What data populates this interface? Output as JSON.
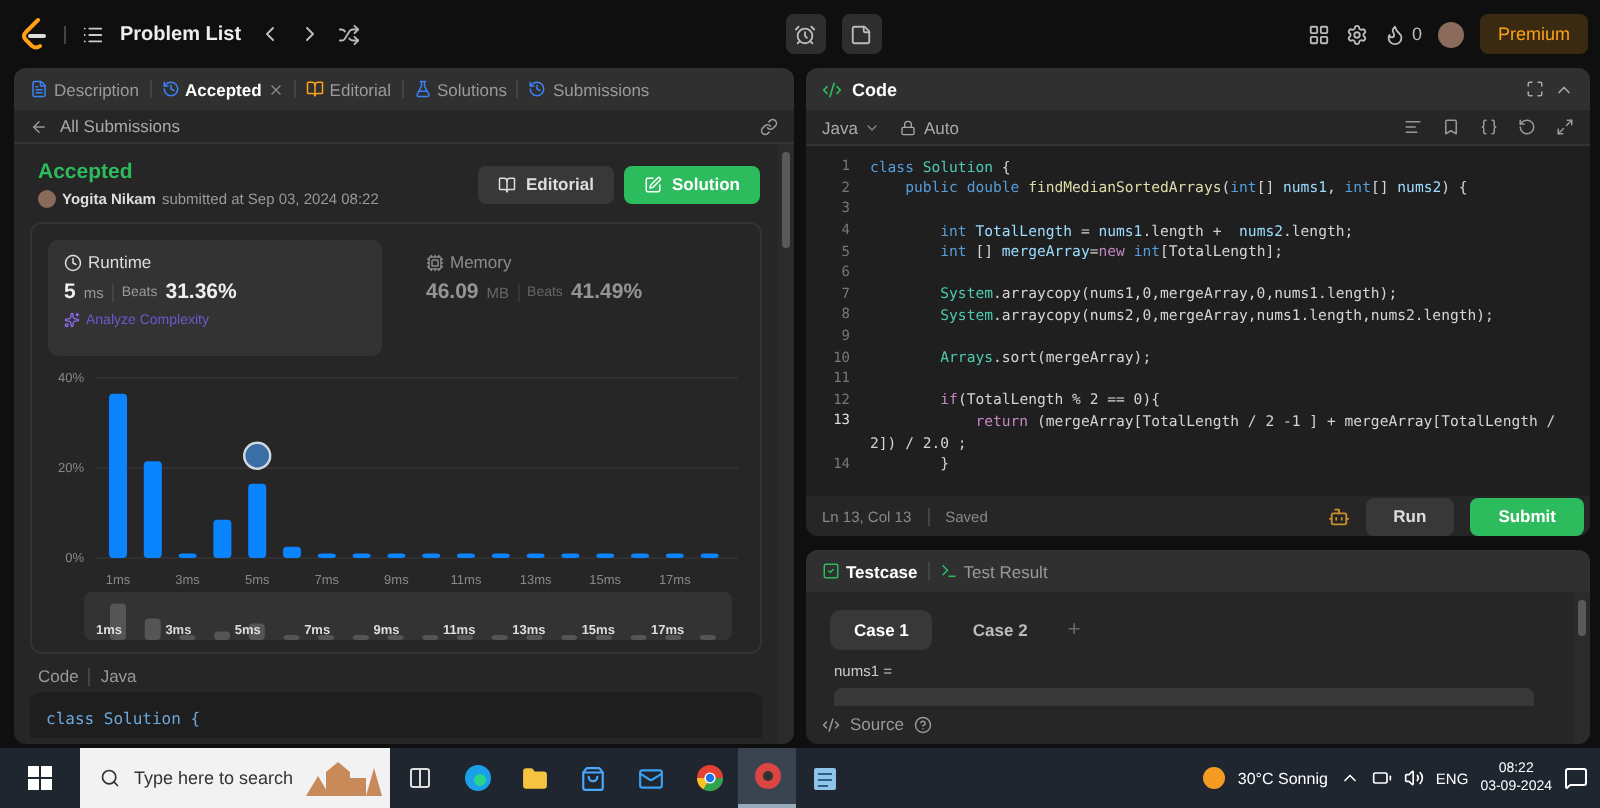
{
  "topbar": {
    "title": "Problem List",
    "streak": "0",
    "premium": "Premium"
  },
  "left": {
    "tabs": [
      {
        "label": "Description",
        "selected": false,
        "closable": false
      },
      {
        "label": "Accepted",
        "selected": true,
        "closable": true
      },
      {
        "label": "Editorial",
        "selected": false,
        "closable": false
      },
      {
        "label": "Solutions",
        "selected": false,
        "closable": false
      },
      {
        "label": "Submissions",
        "selected": false,
        "closable": false
      }
    ],
    "back": "All Submissions",
    "submission": {
      "status": "Accepted",
      "author": "Yogita Nikam",
      "submitted": "submitted at Sep 03, 2024 08:22"
    },
    "buttons": [
      {
        "label": "Editorial",
        "kind": "secondary"
      },
      {
        "label": "Solution",
        "kind": "primary"
      }
    ],
    "stats": [
      {
        "title": "Runtime",
        "value": "5",
        "unit": "ms",
        "beats_label": "Beats",
        "beats": "31.36%",
        "selected": true,
        "extra": "Analyze Complexity"
      },
      {
        "title": "Memory",
        "value": "46.09",
        "unit": "MB",
        "beats_label": "Beats",
        "beats": "41.49%",
        "selected": false
      }
    ],
    "chart_data": {
      "type": "bar",
      "categories": [
        "1ms",
        null,
        "3ms",
        null,
        "5ms",
        null,
        "7ms",
        null,
        "9ms",
        null,
        "11ms",
        null,
        "13ms",
        null,
        "15ms",
        null,
        "17ms",
        null
      ],
      "series": [
        {
          "color": "#0a84ff",
          "values": [
            36.5,
            21.5,
            1,
            8.5,
            16.5,
            2.5,
            1,
            1,
            1,
            1,
            1,
            1,
            1,
            1,
            1,
            1,
            1,
            1
          ]
        }
      ],
      "ylim": [
        0,
        40
      ],
      "yticks": [
        {
          "value": 0,
          "label": "0%"
        },
        {
          "value": 20,
          "label": "20%"
        },
        {
          "value": 40,
          "label": "40%"
        }
      ],
      "annotations": [
        {
          "x": "5ms"
        }
      ]
    },
    "brush_labels": [
      "1ms",
      "3ms",
      "5ms",
      "7ms",
      "9ms",
      "11ms",
      "13ms",
      "15ms",
      "17ms"
    ],
    "code_header": {
      "label": "Code",
      "language": "Java"
    },
    "code_preview": "class Solution {"
  },
  "editor": {
    "title": "Code",
    "language": "Java",
    "mode": "Auto",
    "lines": [
      {
        "n": "1",
        "tokens": [
          {
            "kind": "kw",
            "text": "class "
          },
          {
            "kind": "type",
            "text": "Solution"
          },
          {
            "kind": "plain",
            "text": " {"
          }
        ]
      },
      {
        "n": "2",
        "tokens": [
          {
            "kind": "kw",
            "text": "    public double "
          },
          {
            "kind": "fn",
            "text": "findMedianSortedArrays"
          },
          {
            "kind": "plain",
            "text": "("
          },
          {
            "kind": "kw",
            "text": "int"
          },
          {
            "kind": "plain",
            "text": "[] "
          },
          {
            "kind": "var",
            "text": "nums1"
          },
          {
            "kind": "plain",
            "text": ", "
          },
          {
            "kind": "kw",
            "text": "int"
          },
          {
            "kind": "plain",
            "text": "[] "
          },
          {
            "kind": "var",
            "text": "nums2"
          },
          {
            "kind": "plain",
            "text": ") {"
          }
        ]
      },
      {
        "n": "3"
      },
      {
        "n": "4",
        "tokens": [
          {
            "kind": "kw",
            "text": "        int "
          },
          {
            "kind": "var",
            "text": "TotalLength"
          },
          {
            "kind": "plain",
            "text": " = "
          },
          {
            "kind": "var",
            "text": "nums1"
          },
          {
            "kind": "plain",
            "text": ".length +  "
          },
          {
            "kind": "var",
            "text": "nums2"
          },
          {
            "kind": "plain",
            "text": ".length;"
          }
        ]
      },
      {
        "n": "5",
        "tokens": [
          {
            "kind": "kw",
            "text": "        int "
          },
          {
            "kind": "plain",
            "text": "[] "
          },
          {
            "kind": "var",
            "text": "mergeArray"
          },
          {
            "kind": "plain",
            "text": "="
          },
          {
            "kind": "ctl",
            "text": "new "
          },
          {
            "kind": "kw",
            "text": "int"
          },
          {
            "kind": "plain",
            "text": "[TotalLength];"
          }
        ]
      },
      {
        "n": "6"
      },
      {
        "n": "7",
        "tokens": [
          {
            "kind": "type",
            "text": "        System"
          },
          {
            "kind": "plain",
            "text": ".arraycopy(nums1,0,mergeArray,0,nums1.length);"
          }
        ]
      },
      {
        "n": "8",
        "tokens": [
          {
            "kind": "type",
            "text": "        System"
          },
          {
            "kind": "plain",
            "text": ".arraycopy(nums2,0,mergeArray,nums1.length,nums2.length);"
          }
        ]
      },
      {
        "n": "9"
      },
      {
        "n": "10",
        "tokens": [
          {
            "kind": "type",
            "text": "        Arrays"
          },
          {
            "kind": "plain",
            "text": ".sort(mergeArray);"
          }
        ]
      },
      {
        "n": "11"
      },
      {
        "n": "12",
        "tokens": [
          {
            "kind": "ctl",
            "text": "        if"
          },
          {
            "kind": "plain",
            "text": "(TotalLength % 2 == 0){"
          }
        ]
      },
      {
        "n": "13",
        "tokens": [
          {
            "kind": "ctl",
            "text": "            return "
          },
          {
            "kind": "plain",
            "text": "(mergeArray[TotalLength / 2 -1 ] + mergeArray[TotalLength /"
          }
        ],
        "continuation": "2]) / 2.0 ;"
      },
      {
        "n": "14",
        "tokens": [
          {
            "kind": "plain",
            "text": "        }"
          }
        ]
      }
    ],
    "status": "Ln 13, Col 13",
    "saved": "Saved",
    "buttons": [
      {
        "label": "Run",
        "kind": "secondary"
      },
      {
        "label": "Submit",
        "kind": "primary"
      }
    ]
  },
  "testcase": {
    "tabs": [
      {
        "label": "Testcase",
        "selected": true
      },
      {
        "label": "Test Result",
        "selected": false
      }
    ],
    "cases": [
      {
        "label": "Case 1",
        "selected": true
      },
      {
        "label": "Case 2",
        "selected": false
      }
    ],
    "plus": "+",
    "param": "nums1 =",
    "source": "Source"
  },
  "taskbar": {
    "search_placeholder": "Type here to search",
    "weather": "30°C Sonnig",
    "language": "ENG",
    "time": "08:22",
    "date": "03-09-2024"
  }
}
